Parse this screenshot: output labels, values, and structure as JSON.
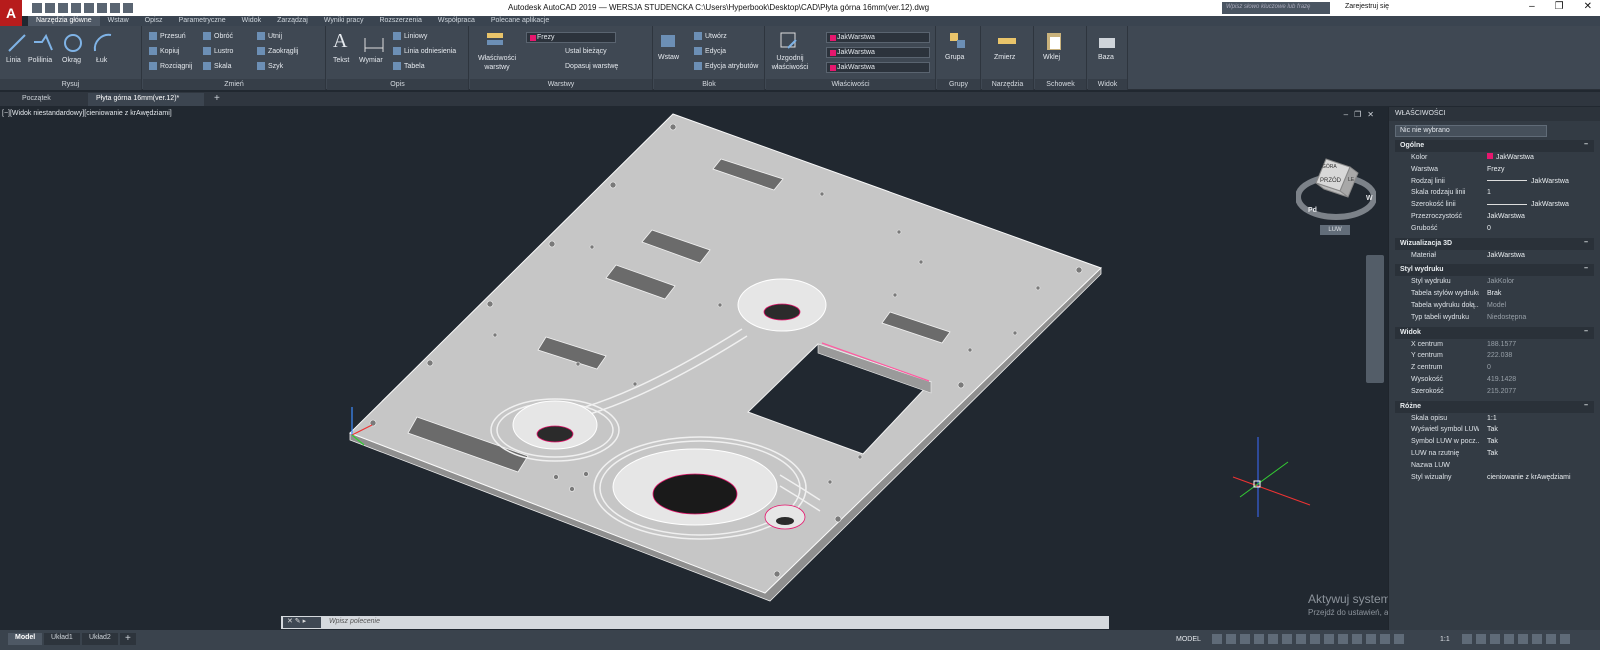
{
  "title_bar": {
    "app_letter": "A",
    "title": "Autodesk AutoCAD 2019 — WERSJA STUDENCKA    C:\\Users\\Hyperbook\\Desktop\\CAD\\Płyta górna 16mm(ver.12).dwg",
    "search_placeholder": "Wpisz słowo kluczowe lub frazę",
    "signin": "Zarejestruj się"
  },
  "menu_tabs": [
    "Narzędzia główne",
    "Wstaw",
    "Opisz",
    "Parametryczne",
    "Widok",
    "Zarządzaj",
    "Wyniki pracy",
    "Rozszerzenia",
    "Współpraca",
    "Polecane aplikacje"
  ],
  "ribbon": {
    "draw": {
      "label": "Rysuj",
      "tools": [
        "Linia",
        "Polilinia",
        "Okrąg",
        "Łuk"
      ]
    },
    "modify": {
      "label": "Zmień",
      "tools": [
        "Przesuń",
        "Obróć",
        "Utnij",
        "Kopiuj",
        "Lustro",
        "Zaokrąglij",
        "Rozciągnij",
        "Skala",
        "Szyk"
      ]
    },
    "annotate": {
      "label": "Opis",
      "tools": [
        "Tekst",
        "Wymiar",
        "Liniowy",
        "Linia odniesienia",
        "Tabela"
      ]
    },
    "layers": {
      "label": "Warstwy",
      "tools": [
        "Właściwości warstwy",
        "Ustal bieżący",
        "Dopasuj warstwę"
      ],
      "current_layer": "Frezy"
    },
    "block": {
      "label": "Blok",
      "tools": [
        "Wstaw",
        "Utwórz",
        "Edycja",
        "Edycja atrybutów"
      ]
    },
    "properties": {
      "label": "Właściwości",
      "tools": [
        "Uzgodnij właściwości"
      ],
      "color": "JakWarstwa",
      "linetype": "JakWarstwa",
      "lineweight": "JakWarstwa"
    },
    "groups": {
      "label": "Grupy",
      "tools": [
        "Grupa"
      ]
    },
    "utilities": {
      "label": "Narzędzia",
      "tools": [
        "Zmierz"
      ]
    },
    "clipboard": {
      "label": "Schowek",
      "tools": [
        "Wklej"
      ]
    },
    "view": {
      "label": "Widok",
      "tools": [
        "Baza"
      ]
    }
  },
  "doc_tabs": [
    "Początek",
    "Płyta górna 16mm(ver.12)*"
  ],
  "viewport": {
    "label": "[−][Widok niestandardowy][cieniowanie z krAwędziami]",
    "viewcube": {
      "top": "GÓRA",
      "front": "PRZÓD",
      "left": "LE",
      "south": "Pd",
      "west": "W",
      "ucs": "LUW"
    }
  },
  "watermark": {
    "line1": "Aktywuj system Windows",
    "line2": "Przejdź do ustawień, aby aktywować system Windows."
  },
  "command_line": {
    "placeholder": "Wpisz polecenie"
  },
  "status_bar": {
    "layout_tabs": [
      "Model",
      "Układ1",
      "Układ2"
    ],
    "model": "MODEL",
    "scale": "1:1"
  },
  "properties_panel": {
    "title": "WŁAŚCIWOŚCI",
    "selection": "Nic nie wybrano",
    "sections": [
      {
        "name": "Ogólne",
        "rows": [
          {
            "key": "Kolor",
            "value": "JakWarstwa",
            "swatch": true
          },
          {
            "key": "Warstwa",
            "value": "Frezy"
          },
          {
            "key": "Rodzaj linii",
            "value": "JakWarstwa",
            "line": true
          },
          {
            "key": "Skala rodzaju linii",
            "value": "1"
          },
          {
            "key": "Szerokość linii",
            "value": "JakWarstwa",
            "line": true
          },
          {
            "key": "Przezroczystość",
            "value": "JakWarstwa"
          },
          {
            "key": "Grubość",
            "value": "0"
          }
        ]
      },
      {
        "name": "Wizualizacja 3D",
        "rows": [
          {
            "key": "Materiał",
            "value": "JakWarstwa"
          }
        ]
      },
      {
        "name": "Styl wydruku",
        "rows": [
          {
            "key": "Styl wydruku",
            "value": "JakKolor",
            "dim": true
          },
          {
            "key": "Tabela stylów wydruku",
            "value": "Brak"
          },
          {
            "key": "Tabela wydruku dołą...",
            "value": "Model",
            "dim": true
          },
          {
            "key": "Typ tabeli wydruku",
            "value": "Niedostępna",
            "dim": true
          }
        ]
      },
      {
        "name": "Widok",
        "rows": [
          {
            "key": "X centrum",
            "value": "188.1577",
            "dim": true
          },
          {
            "key": "Y centrum",
            "value": "222.038",
            "dim": true
          },
          {
            "key": "Z centrum",
            "value": "0",
            "dim": true
          },
          {
            "key": "Wysokość",
            "value": "419.1428",
            "dim": true
          },
          {
            "key": "Szerokość",
            "value": "215.2077",
            "dim": true
          }
        ]
      },
      {
        "name": "Różne",
        "rows": [
          {
            "key": "Skala opisu",
            "value": "1:1"
          },
          {
            "key": "Wyświetl symbol LUW",
            "value": "Tak"
          },
          {
            "key": "Symbol LUW w pocz...",
            "value": "Tak"
          },
          {
            "key": "LUW na rzutnię",
            "value": "Tak"
          },
          {
            "key": "Nazwa LUW",
            "value": ""
          },
          {
            "key": "Styl wizualny",
            "value": "cieniowanie z krAwędziami"
          }
        ]
      }
    ]
  },
  "colors": {
    "accent": "#e6176e",
    "app_red": "#b71c1c",
    "plate": "#c8c8c8"
  }
}
